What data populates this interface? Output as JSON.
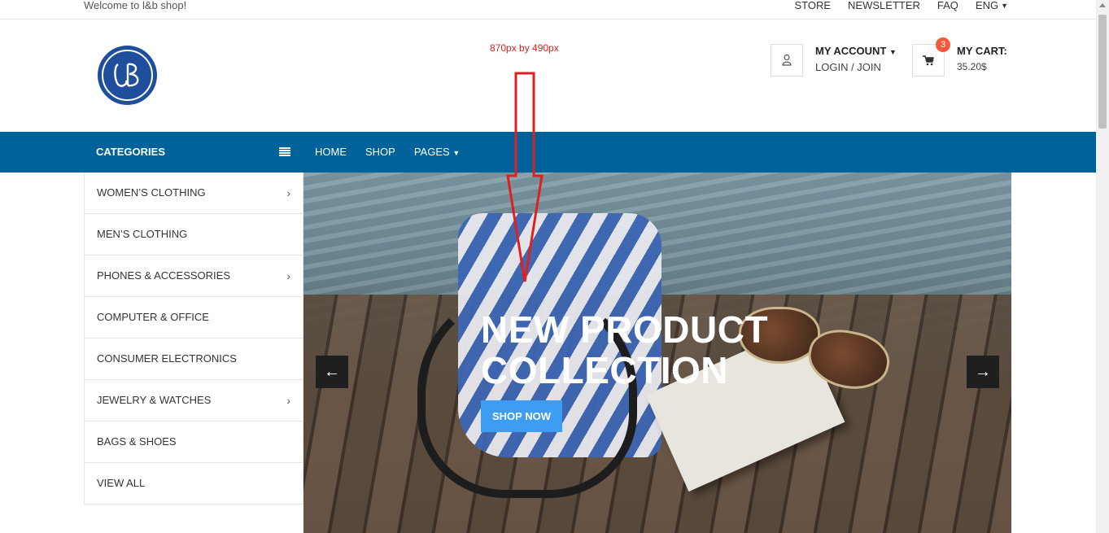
{
  "topbar": {
    "welcome": "Welcome to l&b shop!",
    "links": [
      "STORE",
      "NEWSLETTER",
      "FAQ",
      "ENG"
    ]
  },
  "header": {
    "logo_text": "LB",
    "dimension_note": "870px by 490px",
    "account": {
      "title": "MY ACCOUNT",
      "subtitle": "LOGIN / JOIN"
    },
    "cart": {
      "title": "MY CART:",
      "amount": "35.20$",
      "count": "3"
    }
  },
  "nav": {
    "categories_label": "CATEGORIES",
    "items": [
      "HOME",
      "SHOP",
      "PAGES"
    ]
  },
  "categories": [
    {
      "label": "WOMEN’S CLOTHING",
      "has_submenu": true
    },
    {
      "label": "MEN’S CLOTHING",
      "has_submenu": false
    },
    {
      "label": "PHONES & ACCESSORIES",
      "has_submenu": true
    },
    {
      "label": "COMPUTER & OFFICE",
      "has_submenu": false
    },
    {
      "label": "CONSUMER ELECTRONICS",
      "has_submenu": false
    },
    {
      "label": "JEWELRY & WATCHES",
      "has_submenu": true
    },
    {
      "label": "BAGS & SHOES",
      "has_submenu": false
    },
    {
      "label": "VIEW ALL",
      "has_submenu": false
    }
  ],
  "slider": {
    "headline_line1": "NEW PRODUCT",
    "headline_line2": "COLLECTION",
    "cta": "SHOP NOW",
    "prev_icon": "←",
    "next_icon": "→"
  },
  "colors": {
    "nav_bg": "#00629a",
    "cta_bg": "#3d9df2",
    "badge": "#f15a3a",
    "annotation": "#e02020"
  }
}
